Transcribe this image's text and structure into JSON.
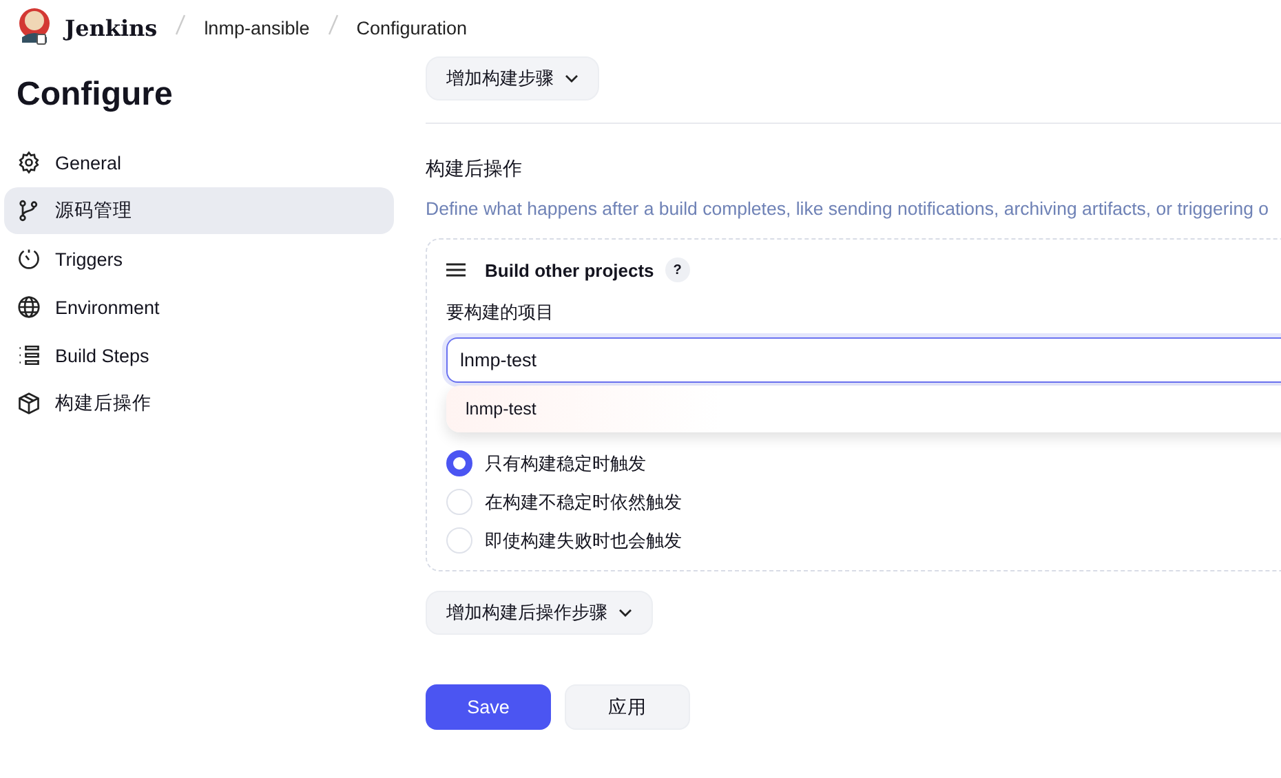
{
  "breadcrumbs": [
    {
      "label": "Jenkins",
      "kind": "brand"
    },
    {
      "label": "lnmp-ansible",
      "kind": "link"
    },
    {
      "label": "Configuration",
      "kind": "link"
    }
  ],
  "page_title": "Configure",
  "sidebar": {
    "items": [
      {
        "label": "General",
        "selected": false
      },
      {
        "label": "源码管理",
        "selected": true
      },
      {
        "label": "Triggers",
        "selected": false
      },
      {
        "label": "Environment",
        "selected": false
      },
      {
        "label": "Build Steps",
        "selected": false
      },
      {
        "label": "构建后操作",
        "selected": false
      }
    ]
  },
  "previous_section": {
    "add_button": "增加构建步骤"
  },
  "section": {
    "title": "构建后操作",
    "description": "Define what happens after a build completes, like sending notifications, archiving artifacts, or triggering o",
    "card": {
      "title": "Build other projects",
      "help": "?",
      "field_label": "要构建的项目",
      "value": "lnmp-test",
      "suggestions": [
        "lnmp-test"
      ],
      "radios": [
        {
          "label": "只有构建稳定时触发",
          "selected": true
        },
        {
          "label": "在构建不稳定时依然触发",
          "selected": false
        },
        {
          "label": "即使构建失败时也会触发",
          "selected": false
        }
      ]
    },
    "add_button": "增加构建后操作步骤"
  },
  "buttons": [
    {
      "label": "Save",
      "kind": "primary"
    },
    {
      "label": "应用",
      "kind": "secondary"
    }
  ]
}
